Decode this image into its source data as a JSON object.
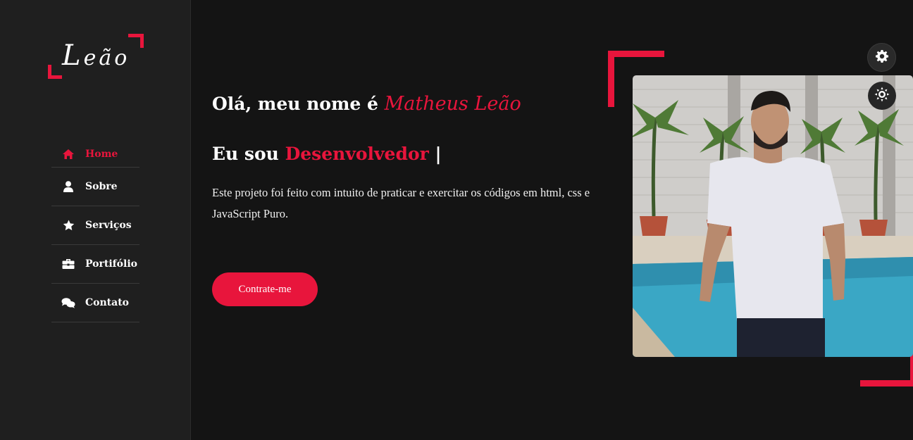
{
  "logo": {
    "initial": "L",
    "rest": "eão"
  },
  "nav": {
    "items": [
      {
        "label": "Home",
        "icon": "home-icon",
        "active": true
      },
      {
        "label": "Sobre",
        "icon": "user-icon",
        "active": false
      },
      {
        "label": "Serviços",
        "icon": "star-icon",
        "active": false
      },
      {
        "label": "Portifólio",
        "icon": "briefcase-icon",
        "active": false
      },
      {
        "label": "Contato",
        "icon": "chat-icon",
        "active": false
      }
    ]
  },
  "hero": {
    "greeting": "Olá, meu nome é",
    "name": "Matheus Leão",
    "role_prefix": "Eu sou",
    "role": "Desenvolvedor",
    "cursor": "|",
    "description": "Este projeto foi feito com intuito de praticar e exercitar os códigos em html, css e JavaScript Puro.",
    "cta_label": "Contrate-me"
  },
  "colors": {
    "accent": "#e8153c",
    "background": "#141414",
    "sidebar": "#1f1f1f"
  },
  "controls": {
    "settings_icon": "gear-icon",
    "theme_icon": "sun-icon"
  }
}
